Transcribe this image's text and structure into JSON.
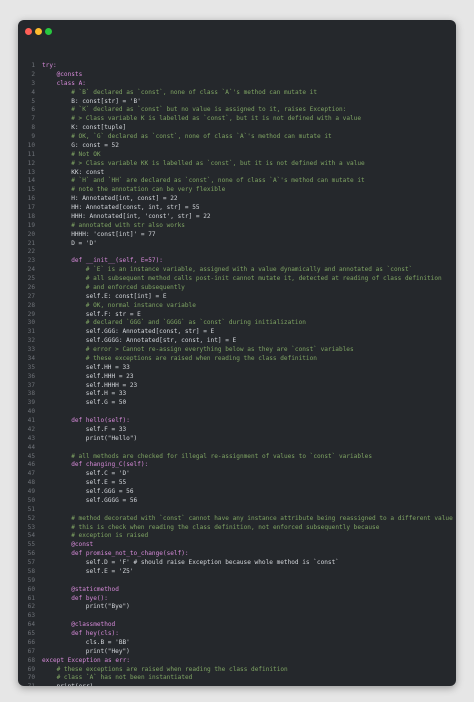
{
  "window": {
    "colors": {
      "background": "#25282c",
      "close": "#ff5f57",
      "minimize": "#febc2e",
      "maximize": "#28c840"
    }
  },
  "code": {
    "lines": [
      {
        "n": "1",
        "indent": 0,
        "text": "try:",
        "type": "kw"
      },
      {
        "n": "2",
        "indent": 1,
        "text": "@consts",
        "type": "dec"
      },
      {
        "n": "3",
        "indent": 1,
        "text": "class A:",
        "type": "def"
      },
      {
        "n": "4",
        "indent": 2,
        "text": "# `B` declared as `const`, none of class `A`'s method can mutate it",
        "type": "cm"
      },
      {
        "n": "5",
        "indent": 2,
        "text": "B: const[str] = 'B'",
        "type": "code"
      },
      {
        "n": "6",
        "indent": 2,
        "text": "# `K` declared as `const` but no value is assigned to it, raises Exception:",
        "type": "cm"
      },
      {
        "n": "7",
        "indent": 2,
        "text": "# > Class variable K is labelled as `const`, but it is not defined with a value",
        "type": "cm"
      },
      {
        "n": "8",
        "indent": 2,
        "text": "K: const[tuple]",
        "type": "code"
      },
      {
        "n": "9",
        "indent": 2,
        "text": "# OK, `G` declared as `const`, none of class `A`'s method can mutate it",
        "type": "cm"
      },
      {
        "n": "10",
        "indent": 2,
        "text": "G: const = 52",
        "type": "code"
      },
      {
        "n": "11",
        "indent": 2,
        "text": "# Not OK",
        "type": "cm"
      },
      {
        "n": "12",
        "indent": 2,
        "text": "# > Class variable KK is labelled as `const`, but it is not defined with a value",
        "type": "cm"
      },
      {
        "n": "13",
        "indent": 2,
        "text": "KK: const",
        "type": "code"
      },
      {
        "n": "14",
        "indent": 2,
        "text": "# `H` and `HH` are declared as `const`, none of class `A`'s method can mutate it",
        "type": "cm"
      },
      {
        "n": "15",
        "indent": 2,
        "text": "# note the annotation can be very flexible",
        "type": "cm"
      },
      {
        "n": "16",
        "indent": 2,
        "text": "H: Annotated[int, const] = 22",
        "type": "code"
      },
      {
        "n": "17",
        "indent": 2,
        "text": "HH: Annotated[const, int, str] = 55",
        "type": "code"
      },
      {
        "n": "18",
        "indent": 2,
        "text": "HHH: Annotated[int, 'const', str] = 22",
        "type": "code"
      },
      {
        "n": "19",
        "indent": 2,
        "text": "# annotated with str also works",
        "type": "cm"
      },
      {
        "n": "20",
        "indent": 2,
        "text": "HHHH: 'const[int]' = 77",
        "type": "code"
      },
      {
        "n": "21",
        "indent": 2,
        "text": "D = 'D'",
        "type": "code"
      },
      {
        "n": "22",
        "indent": 0,
        "text": "",
        "type": "code"
      },
      {
        "n": "23",
        "indent": 2,
        "text": "def __init__(self, E=57):",
        "type": "def"
      },
      {
        "n": "24",
        "indent": 3,
        "text": "# `E` is an instance variable, assigned with a value dynamically and annotated as `const`",
        "type": "cm"
      },
      {
        "n": "25",
        "indent": 3,
        "text": "# all subsequent method calls post-init cannot mutate it, detected at reading of class definition",
        "type": "cm"
      },
      {
        "n": "26",
        "indent": 3,
        "text": "# and enforced subsequently",
        "type": "cm"
      },
      {
        "n": "27",
        "indent": 3,
        "text": "self.E: const[int] = E",
        "type": "code"
      },
      {
        "n": "28",
        "indent": 3,
        "text": "# OK, normal instance variable",
        "type": "cm"
      },
      {
        "n": "29",
        "indent": 3,
        "text": "self.F: str = E",
        "type": "code"
      },
      {
        "n": "30",
        "indent": 3,
        "text": "# declared `GGG` and `GGGG` as `const` during initialization",
        "type": "cm"
      },
      {
        "n": "31",
        "indent": 3,
        "text": "self.GGG: Annotated[const, str] = E",
        "type": "code"
      },
      {
        "n": "32",
        "indent": 3,
        "text": "self.GGGG: Annotated[str, const, int] = E",
        "type": "code"
      },
      {
        "n": "33",
        "indent": 3,
        "text": "# error > Cannot re-assign everything below as they are `const` variables",
        "type": "cm"
      },
      {
        "n": "34",
        "indent": 3,
        "text": "# these exceptions are raised when reading the class definition",
        "type": "cm"
      },
      {
        "n": "35",
        "indent": 3,
        "text": "self.HH = 33",
        "type": "code"
      },
      {
        "n": "36",
        "indent": 3,
        "text": "self.HHH = 23",
        "type": "code"
      },
      {
        "n": "37",
        "indent": 3,
        "text": "self.HHHH = 23",
        "type": "code"
      },
      {
        "n": "38",
        "indent": 3,
        "text": "self.H = 33",
        "type": "code"
      },
      {
        "n": "39",
        "indent": 3,
        "text": "self.G = 50",
        "type": "code"
      },
      {
        "n": "40",
        "indent": 0,
        "text": "",
        "type": "code"
      },
      {
        "n": "41",
        "indent": 2,
        "text": "def hello(self):",
        "type": "def"
      },
      {
        "n": "42",
        "indent": 3,
        "text": "self.F = 33",
        "type": "code"
      },
      {
        "n": "43",
        "indent": 3,
        "text": "print(\"Hello\")",
        "type": "code"
      },
      {
        "n": "44",
        "indent": 0,
        "text": "",
        "type": "code"
      },
      {
        "n": "45",
        "indent": 2,
        "text": "# all methods are checked for illegal re-assignment of values to `const` variables",
        "type": "cm"
      },
      {
        "n": "46",
        "indent": 2,
        "text": "def changing_C(self):",
        "type": "def"
      },
      {
        "n": "47",
        "indent": 3,
        "text": "self.C = 'D'",
        "type": "code"
      },
      {
        "n": "48",
        "indent": 3,
        "text": "self.E = 55",
        "type": "code"
      },
      {
        "n": "49",
        "indent": 3,
        "text": "self.GGG = 56",
        "type": "code"
      },
      {
        "n": "50",
        "indent": 3,
        "text": "self.GGGG = 56",
        "type": "code"
      },
      {
        "n": "51",
        "indent": 0,
        "text": "",
        "type": "code"
      },
      {
        "n": "52",
        "indent": 2,
        "text": "# method decorated with `const` cannot have any instance attribute being reassigned to a different value",
        "type": "cm"
      },
      {
        "n": "53",
        "indent": 2,
        "text": "# this is check when reading the class definition, not enforced subsequently because",
        "type": "cm"
      },
      {
        "n": "54",
        "indent": 2,
        "text": "# exception is raised",
        "type": "cm"
      },
      {
        "n": "55",
        "indent": 2,
        "text": "@const",
        "type": "dec"
      },
      {
        "n": "56",
        "indent": 2,
        "text": "def promise_not_to_change(self):",
        "type": "def"
      },
      {
        "n": "57",
        "indent": 3,
        "text": "self.D = 'F' # should raise Exception because whole method is `const`",
        "type": "code"
      },
      {
        "n": "58",
        "indent": 3,
        "text": "self.E = 'Z5'",
        "type": "code"
      },
      {
        "n": "59",
        "indent": 0,
        "text": "",
        "type": "code"
      },
      {
        "n": "60",
        "indent": 2,
        "text": "@staticmethod",
        "type": "dec"
      },
      {
        "n": "61",
        "indent": 2,
        "text": "def bye():",
        "type": "def"
      },
      {
        "n": "62",
        "indent": 3,
        "text": "print(\"Bye\")",
        "type": "code"
      },
      {
        "n": "63",
        "indent": 0,
        "text": "",
        "type": "code"
      },
      {
        "n": "64",
        "indent": 2,
        "text": "@classmethod",
        "type": "dec"
      },
      {
        "n": "65",
        "indent": 2,
        "text": "def hey(cls):",
        "type": "def"
      },
      {
        "n": "66",
        "indent": 3,
        "text": "cls.B = 'BB'",
        "type": "code"
      },
      {
        "n": "67",
        "indent": 3,
        "text": "print(\"Hey\")",
        "type": "code"
      },
      {
        "n": "68",
        "indent": 0,
        "text": "except Exception as err:",
        "type": "kw"
      },
      {
        "n": "69",
        "indent": 1,
        "text": "# these exceptions are raised when reading the class definition",
        "type": "cm"
      },
      {
        "n": "70",
        "indent": 1,
        "text": "# class `A` has not been instantiated",
        "type": "cm"
      },
      {
        "n": "71",
        "indent": 1,
        "text": "print(err)",
        "type": "code"
      }
    ]
  }
}
